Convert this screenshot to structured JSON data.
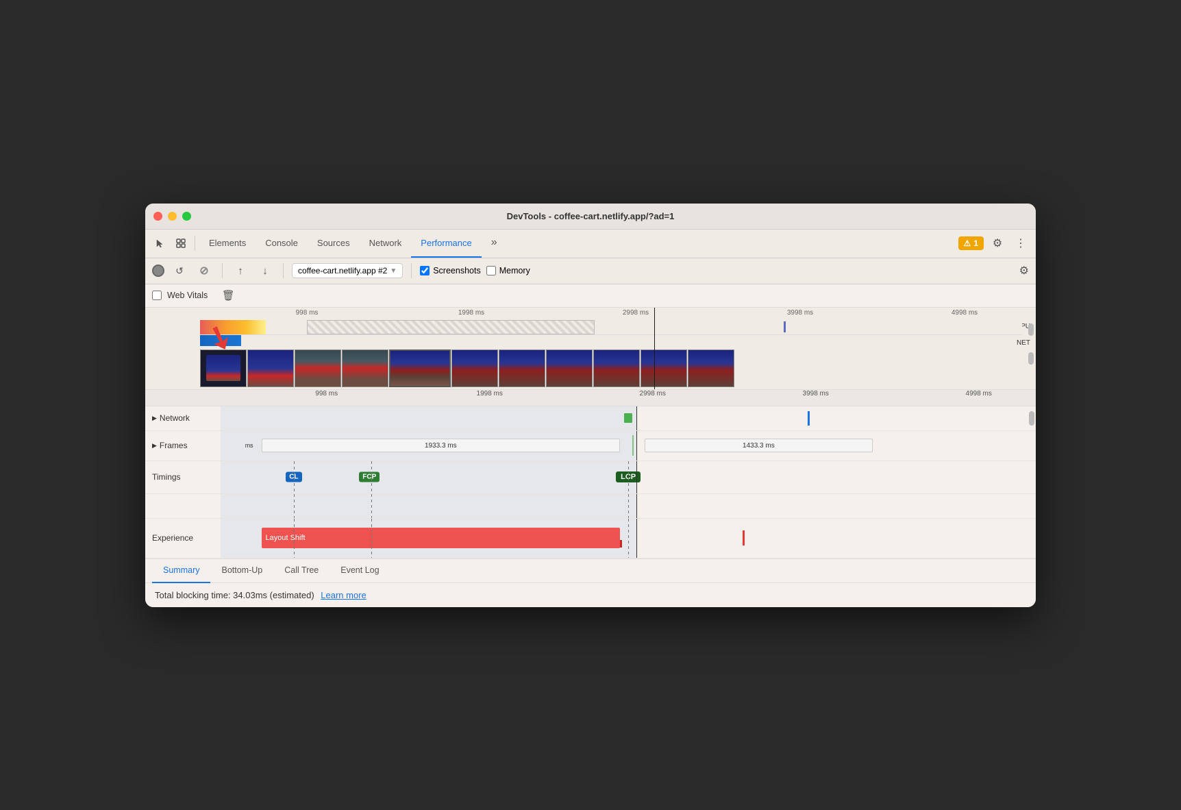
{
  "window": {
    "title": "DevTools - coffee-cart.netlify.app/?ad=1"
  },
  "toolbar": {
    "tabs": [
      {
        "label": "Elements",
        "active": false
      },
      {
        "label": "Console",
        "active": false
      },
      {
        "label": "Sources",
        "active": false
      },
      {
        "label": "Network",
        "active": false
      },
      {
        "label": "Performance",
        "active": true
      },
      {
        "label": "»",
        "active": false
      }
    ],
    "badge_label": "1",
    "more_icon": "⋮",
    "settings_icon": "⚙"
  },
  "record_bar": {
    "url": "coffee-cart.netlify.app #2",
    "screenshots_label": "Screenshots",
    "memory_label": "Memory"
  },
  "webvitals": {
    "label": "Web Vitals"
  },
  "timeline": {
    "time_marks": [
      "998 ms",
      "1998 ms",
      "2998 ms",
      "3998 ms",
      "4998 ms"
    ],
    "time_marks2": [
      "998 ms",
      "1998 ms",
      "2998 ms",
      "3998 ms",
      "4998 ms"
    ],
    "cpu_label": "CPU",
    "net_label": "NET",
    "tracks": [
      {
        "label": "Network",
        "collapsible": true
      },
      {
        "label": "Frames",
        "collapsible": true,
        "values": [
          "ms",
          "1933.3 ms",
          "1433.3 ms"
        ]
      },
      {
        "label": "Timings",
        "badges": [
          {
            "text": "CL",
            "color": "#1565c0",
            "left": "12%"
          },
          {
            "text": "FCP",
            "color": "#2e7d32",
            "left": "18%"
          },
          {
            "text": "LCP",
            "color": "#1b5e20",
            "left": "49%"
          }
        ]
      },
      {
        "label": "Experience"
      }
    ],
    "layout_shift": {
      "label": "Layout Shift",
      "left": "15%",
      "width": "35%"
    }
  },
  "bottom": {
    "tabs": [
      {
        "label": "Summary",
        "active": true
      },
      {
        "label": "Bottom-Up",
        "active": false
      },
      {
        "label": "Call Tree",
        "active": false
      },
      {
        "label": "Event Log",
        "active": false
      }
    ],
    "summary_text": "Total blocking time: 34.03ms (estimated)",
    "learn_more": "Learn more"
  }
}
